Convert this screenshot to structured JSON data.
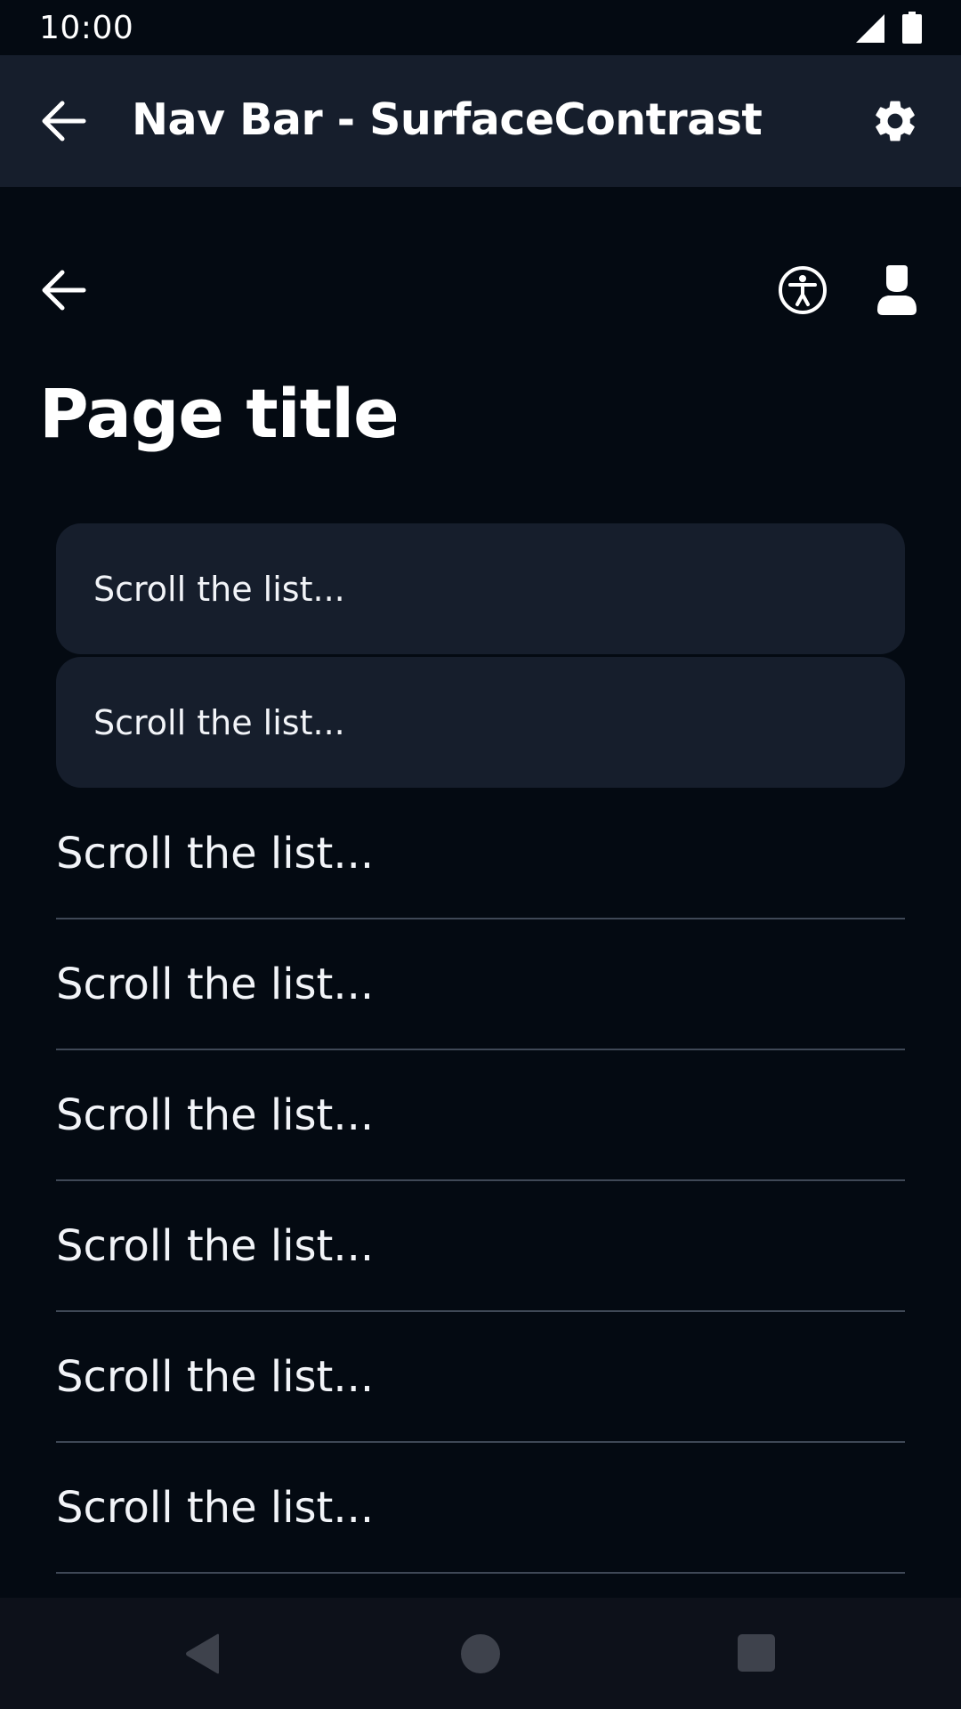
{
  "status_bar": {
    "time": "10:00"
  },
  "app_bar": {
    "title": "Nav Bar - SurfaceContrast"
  },
  "page": {
    "title": "Page title"
  },
  "cards": [
    {
      "label": "Scroll the list..."
    },
    {
      "label": "Scroll the list..."
    }
  ],
  "list_items": [
    {
      "label": "Scroll the list..."
    },
    {
      "label": "Scroll the list..."
    },
    {
      "label": "Scroll the list..."
    },
    {
      "label": "Scroll the list..."
    },
    {
      "label": "Scroll the list..."
    },
    {
      "label": "Scroll the list..."
    }
  ],
  "colors": {
    "background": "#040a12",
    "surface": "#161e2c",
    "divider": "#3f4856",
    "system_nav": "#0d111a",
    "system_nav_icons": "#3e424c"
  },
  "icons": [
    "signal-icon",
    "battery-icon",
    "back-arrow-icon",
    "settings-gear-icon",
    "accessibility-icon",
    "user-icon",
    "nav-back-triangle-icon",
    "nav-home-circle-icon",
    "nav-recents-square-icon"
  ]
}
